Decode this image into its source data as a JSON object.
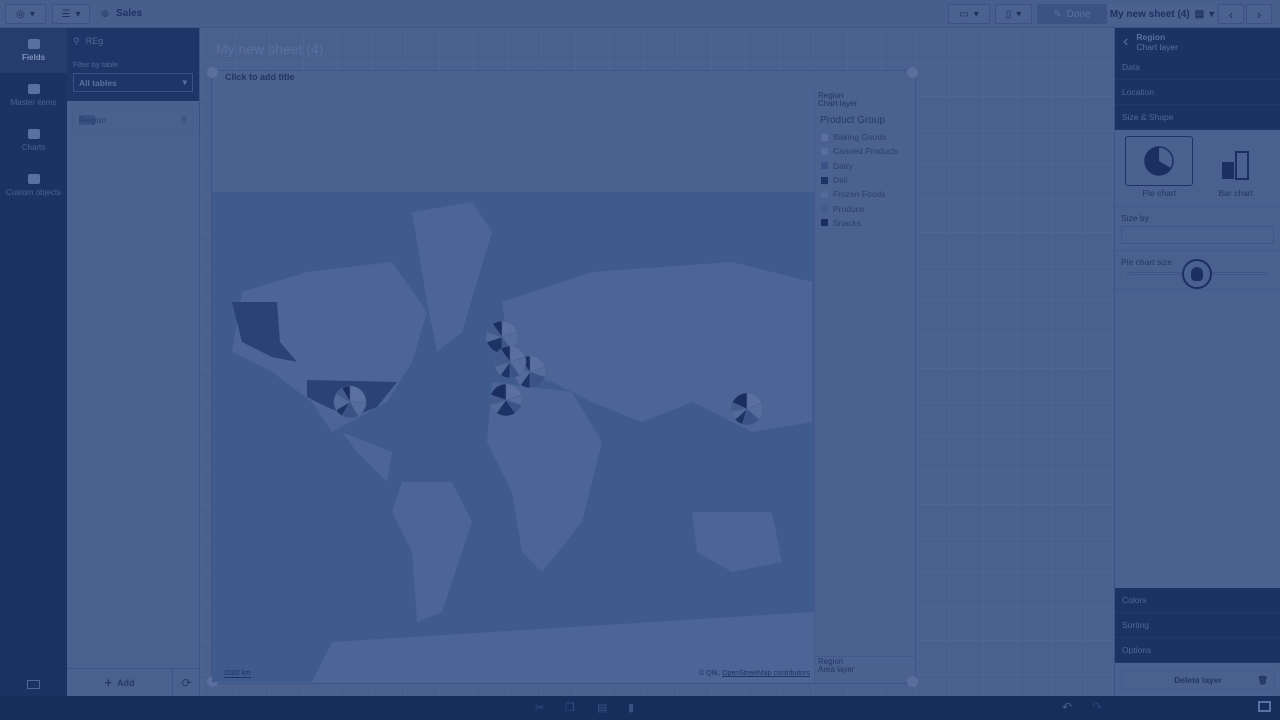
{
  "topbar": {
    "app_name": "Sales",
    "done_label": "Done",
    "sheet_name": "My new sheet (4)"
  },
  "leftnav": {
    "items": [
      {
        "label": "Fields",
        "icon": "database-icon"
      },
      {
        "label": "Master items",
        "icon": "link-icon"
      },
      {
        "label": "Charts",
        "icon": "bar-chart-icon"
      },
      {
        "label": "Custom objects",
        "icon": "puzzle-icon"
      }
    ]
  },
  "fields": {
    "search_value": "REg",
    "filter_label": "Filter by table",
    "table_select": "All tables",
    "items": [
      {
        "highlight": "Reg",
        "rest": "ion"
      }
    ],
    "add_label": "Add"
  },
  "sheet": {
    "title": "My new sheet (4)",
    "chart_title_placeholder": "Click to add title"
  },
  "map": {
    "scale": "2000 km",
    "attribution_prefix": "© Qlik,",
    "attribution_link": "OpenStreetMap contributors",
    "pies": [
      {
        "region": "North America",
        "values": [
          3,
          2,
          2,
          1,
          2,
          1,
          1
        ]
      },
      {
        "region": "Northern Europe",
        "values": [
          2,
          2,
          1,
          2,
          1,
          1,
          1
        ]
      },
      {
        "region": "Central Europe",
        "values": [
          2,
          1,
          2,
          1,
          2,
          1,
          1
        ]
      },
      {
        "region": "Western Europe",
        "values": [
          2,
          2,
          1,
          1,
          1,
          2,
          1
        ]
      },
      {
        "region": "Southern Europe",
        "values": [
          2,
          1,
          1,
          2,
          1,
          1,
          2
        ]
      },
      {
        "region": "Japan",
        "values": [
          2,
          2,
          2,
          1,
          1,
          1,
          2
        ]
      }
    ]
  },
  "legend": {
    "top_layer": "Region",
    "top_layer_type": "Chart layer",
    "title": "Product Group",
    "items": [
      {
        "label": "Baking Goods",
        "color": "#5b70a0"
      },
      {
        "label": "Canned Products",
        "color": "#566c9c"
      },
      {
        "label": "Dairy",
        "color": "#3b5286"
      },
      {
        "label": "Deli",
        "color": "#1c3366"
      },
      {
        "label": "Frozen Foods",
        "color": "#52699a"
      },
      {
        "label": "Produce",
        "color": "#42598c"
      },
      {
        "label": "Snacks",
        "color": "#1a2f5f"
      }
    ],
    "bottom_layer": "Region",
    "bottom_layer_type": "Area layer"
  },
  "props": {
    "title": "Region",
    "subtitle": "Chart layer",
    "sections_top": [
      "Data",
      "Location",
      "Size & Shape"
    ],
    "shape_options": [
      "Pie chart",
      "Bar chart"
    ],
    "selected_shape": "Pie chart",
    "size_by_label": "Size by",
    "size_by_value": "",
    "fx_label": "fx",
    "pie_size_label": "Pie chart size",
    "pie_size_level": 0.5,
    "sections_bottom": [
      "Colors",
      "Sorting",
      "Options"
    ],
    "delete_label": "Delete layer"
  }
}
